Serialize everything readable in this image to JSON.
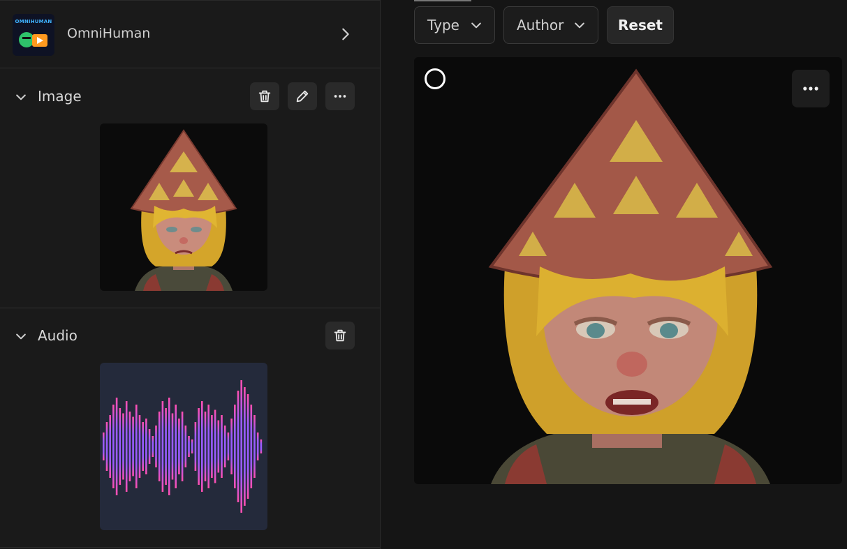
{
  "model": {
    "name": "OmniHuman",
    "thumbnail_text": "OMNIHUMAN",
    "icon": "chevron-right-icon"
  },
  "image_section": {
    "title": "Image",
    "actions": [
      "trash-icon",
      "pencil-icon",
      "more-horizontal-icon"
    ]
  },
  "audio_section": {
    "title": "Audio",
    "actions": [
      "trash-icon"
    ]
  },
  "filters": {
    "type_label": "Type",
    "author_label": "Author",
    "reset_label": "Reset"
  },
  "colors": {
    "accent_wave_top": "#9a5cff",
    "accent_wave_bottom": "#ff4fb0",
    "audio_bg": "#242a3b"
  }
}
